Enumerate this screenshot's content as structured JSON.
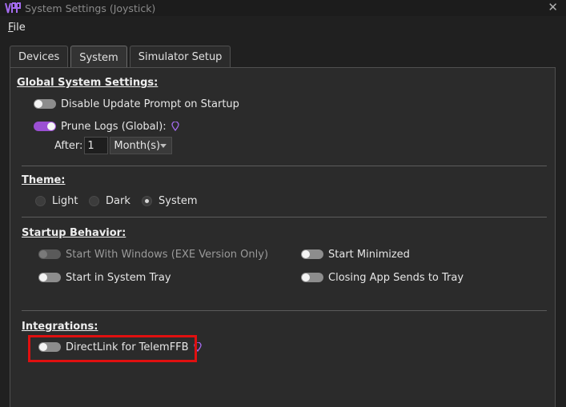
{
  "window": {
    "title": "System Settings (Joystick)",
    "close_glyph": "✕",
    "logo_icon": "vpforce-logo-icon"
  },
  "menu": {
    "file_first": "F",
    "file_rest": "ile"
  },
  "tabs": [
    {
      "label": "Devices",
      "active": false
    },
    {
      "label": "System",
      "active": true
    },
    {
      "label": "Simulator Setup",
      "active": false
    }
  ],
  "global": {
    "title": "Global System Settings:",
    "disable_update": {
      "label": "Disable Update Prompt on Startup",
      "on": false
    },
    "prune_logs": {
      "label": "Prune Logs (Global):",
      "on": true
    },
    "after_label": "After:",
    "after_value": "1",
    "after_unit": "Month(s)"
  },
  "theme": {
    "title": "Theme:",
    "options": [
      {
        "label": "Light",
        "checked": false
      },
      {
        "label": "Dark",
        "checked": false
      },
      {
        "label": "System",
        "checked": true
      }
    ]
  },
  "startup": {
    "title": "Startup Behavior:",
    "start_with_windows": {
      "label": "Start With Windows (EXE Version Only)",
      "disabled": true
    },
    "start_minimized": {
      "label": "Start Minimized"
    },
    "start_in_tray": {
      "label": "Start in System Tray"
    },
    "closing_sends_tray": {
      "label": "Closing App Sends to Tray"
    }
  },
  "integrations": {
    "title": "Integrations:",
    "directlink": {
      "label": "DirectLink for TelemFFB",
      "on": false
    }
  },
  "colors": {
    "accent": "#9b4fd3",
    "highlight": "#e01010"
  }
}
